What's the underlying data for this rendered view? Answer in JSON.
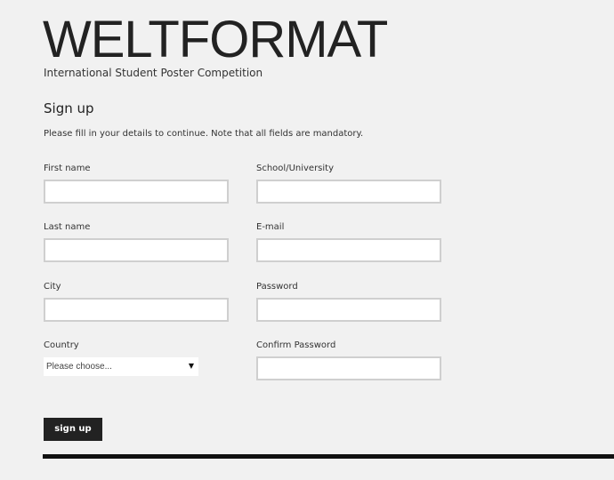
{
  "brand": {
    "title": "WELTFORMAT",
    "subtitle": "International Student Poster Competition"
  },
  "form": {
    "heading": "Sign up",
    "intro": "Please fill in your details to continue. Note that all fields are mandatory.",
    "fields": {
      "first_name": {
        "label": "First name",
        "value": "",
        "placeholder": ""
      },
      "school_university": {
        "label": "School/University",
        "value": "",
        "placeholder": ""
      },
      "last_name": {
        "label": "Last name",
        "value": "",
        "placeholder": ""
      },
      "email": {
        "label": "E-mail",
        "value": "",
        "placeholder": ""
      },
      "city": {
        "label": "City",
        "value": "",
        "placeholder": ""
      },
      "password": {
        "label": "Password",
        "value": "",
        "placeholder": ""
      },
      "country": {
        "label": "Country",
        "selected": "Please choose...",
        "arrow_icon": "triangle-down"
      },
      "confirm_password": {
        "label": "Confirm Password",
        "value": "",
        "placeholder": ""
      }
    },
    "submit_label": "sign up"
  },
  "colors": {
    "background": "#f1f1f1",
    "text": "#222222",
    "input_border": "#cfcfcf",
    "button": "#222222"
  }
}
